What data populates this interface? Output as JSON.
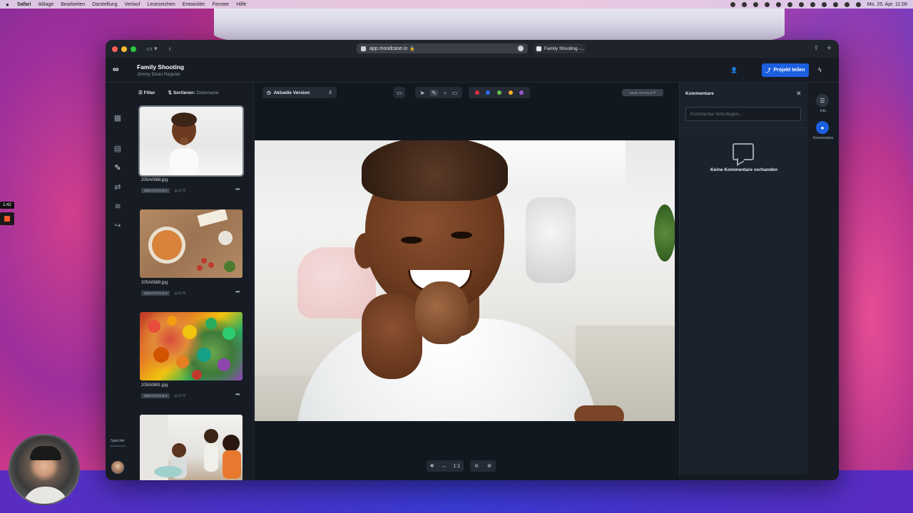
{
  "menubar": {
    "apple": "",
    "items": [
      "Safari",
      "Ablage",
      "Bearbeiten",
      "Darstellung",
      "Verlauf",
      "Lesezeichen",
      "Entwickler",
      "Fenster",
      "Hilfe"
    ],
    "clock": "Mo. 25. Apr.  11:06"
  },
  "recording": {
    "time": "1:42"
  },
  "browser": {
    "url": "app.moodcase.io",
    "tab_title": "Family Shooting -..."
  },
  "app": {
    "project_title": "Family Shooting",
    "project_subtitle": "Jimmy Dean Regular",
    "share_label": "Projekt teilen",
    "logo": "∞"
  },
  "sidebar": {
    "storage_label": "Speicher"
  },
  "filelist": {
    "filter_label": "Filter",
    "sort_label": "Sortieren:",
    "sort_value": "Dateiname",
    "files": [
      {
        "name": "205A0688.jpg",
        "status": "KEIN STATUS",
        "count": "0 / 0"
      },
      {
        "name": "205A0689.jpg",
        "status": "KEIN STATUS",
        "count": "0 / 0"
      },
      {
        "name": "205A0691.jpg",
        "status": "KEIN STATUS",
        "count": "0 / 0"
      },
      {
        "name": "",
        "status": "",
        "count": ""
      }
    ]
  },
  "viewer": {
    "version_label": "Aktuelle Version",
    "status_label": "KEIN STATUS",
    "zoom_1to1": "1:1",
    "colors": [
      "#e0313c",
      "#2a6cf0",
      "#62c24a",
      "#f5b12a",
      "#9b59d6"
    ]
  },
  "comments": {
    "title": "Kommentare",
    "placeholder": "Kommentar hinzufügen...",
    "empty_text": "Keine Kommentare vorhanden"
  },
  "rightrail": {
    "info_label": "Info",
    "comments_label": "Kommentare"
  }
}
